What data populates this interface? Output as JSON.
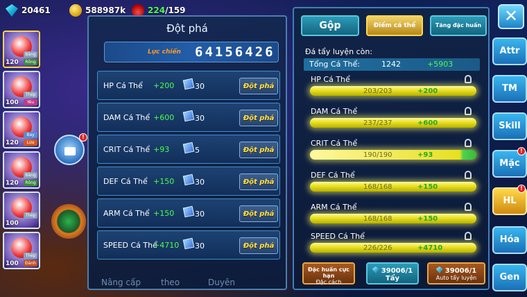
{
  "resources": {
    "gems": "20461",
    "gold": "588987k",
    "energy_current": "224",
    "energy_max": "/159"
  },
  "left_cards": [
    {
      "level": "120",
      "type1": "Băng",
      "type2": "Rồng"
    },
    {
      "level": "100",
      "type1": "Thép",
      "type2": "Yêu"
    },
    {
      "level": "120",
      "type1": "Bay",
      "type2": "Lửa"
    },
    {
      "level": "120",
      "type1": "Băng",
      "type2": "Rồng"
    },
    {
      "level": "100",
      "type1": "Thép",
      "type2": ""
    },
    {
      "level": "100",
      "type1": "Thép",
      "type2": "Đánh"
    }
  ],
  "breakthrough": {
    "title": "Đột phá",
    "power_label": "Lực chiến",
    "power_value": "64156426",
    "button_label": "Đột phá",
    "rows": [
      {
        "stat": "HP Cá Thể",
        "bonus": "+200",
        "cost": "30"
      },
      {
        "stat": "DAM Cá Thể",
        "bonus": "+600",
        "cost": "30"
      },
      {
        "stat": "CRIT Cá Thể",
        "bonus": "+93",
        "cost": "5"
      },
      {
        "stat": "DEF Cá Thể",
        "bonus": "+150",
        "cost": "30"
      },
      {
        "stat": "ARM Cá Thể",
        "bonus": "+150",
        "cost": "30"
      },
      {
        "stat": "SPEED Cá Thể",
        "bonus": "+4710",
        "cost": "30"
      }
    ],
    "ghost_labels": [
      "Nâng cấp",
      "theo",
      "Duyên"
    ]
  },
  "merge": {
    "tab_gop": "Gộp",
    "tab_diem": "Điểm cá thể",
    "tab_tang": "Tăng đặc huấn",
    "subtitle": "Đá tẩy luyện còn:",
    "total_label": "Tổng Cá Thể:",
    "total_value": "1242",
    "total_plus": "+5903",
    "stats": [
      {
        "name": "HP Cá Thể",
        "value": "203/203",
        "add": "+200",
        "fill_pct": 100
      },
      {
        "name": "DAM Cá Thể",
        "value": "237/237",
        "add": "+600",
        "fill_pct": 100
      },
      {
        "name": "CRIT Cá Thể",
        "value": "190/190",
        "add": "+93",
        "fill_pct": 100
      },
      {
        "name": "DEF Cá Thể",
        "value": "168/168",
        "add": "+150",
        "fill_pct": 100
      },
      {
        "name": "ARM Cá Thể",
        "value": "168/168",
        "add": "+150",
        "fill_pct": 100
      },
      {
        "name": "SPEED Cá Thể",
        "value": "226/226",
        "add": "+4710",
        "fill_pct": 100
      }
    ],
    "btn_dac_top": "Đặc huấn cực hạn",
    "btn_dac_bot": "Đặc cách",
    "btn_tay_count": "39006/1",
    "btn_tay_label": "Tẩy",
    "btn_auto_count": "39006/1",
    "btn_auto_label": "Auto tẩy luyện"
  },
  "nav": {
    "close": "✕",
    "items": [
      "Attr",
      "TM",
      "Skill",
      "Mặc",
      "HL",
      "Hóa",
      "Gen"
    ],
    "badge": "!"
  }
}
